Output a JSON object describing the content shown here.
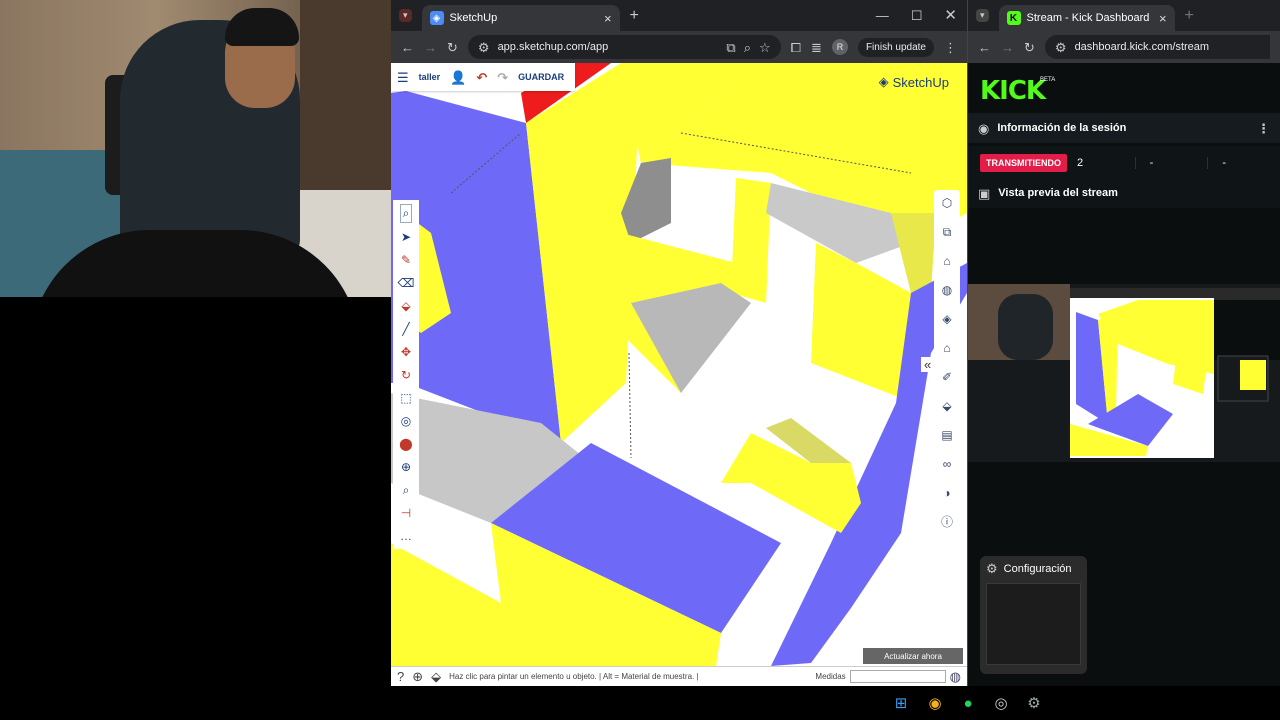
{
  "sketchup_browser": {
    "tab_title": "SketchUp",
    "url": "app.sketchup.com/app",
    "finish_update_label": "Finish update",
    "profile_initial": "R",
    "toolbar": {
      "folder_label": "taller",
      "save_label": "GUARDAR"
    },
    "logo_text": "SketchUp",
    "status_hint": "Haz clic para pintar un elemento u objeto. | Alt = Material de muestra. |",
    "measures_label": "Medidas",
    "update_now_label": "Actualizar ahora",
    "panel_toggle": "«"
  },
  "kick_browser": {
    "tab_title": "Stream - Kick Dashboard",
    "url": "dashboard.kick.com/stream",
    "logo": "KICK",
    "logo_badge": "BETA",
    "session_info_title": "Información de la sesión",
    "live_badge": "TRANSMITIENDO",
    "stats": [
      "2",
      "-",
      "-"
    ],
    "preview_title": "Vista previa del stream"
  },
  "settings_popup": {
    "title": "Configuración"
  },
  "colors": {
    "face_yellow": "#ffff33",
    "face_blue": "#6e6af7",
    "face_red": "#ee1c1c",
    "kick_green": "#53fc18",
    "live_red": "#e11d48"
  }
}
